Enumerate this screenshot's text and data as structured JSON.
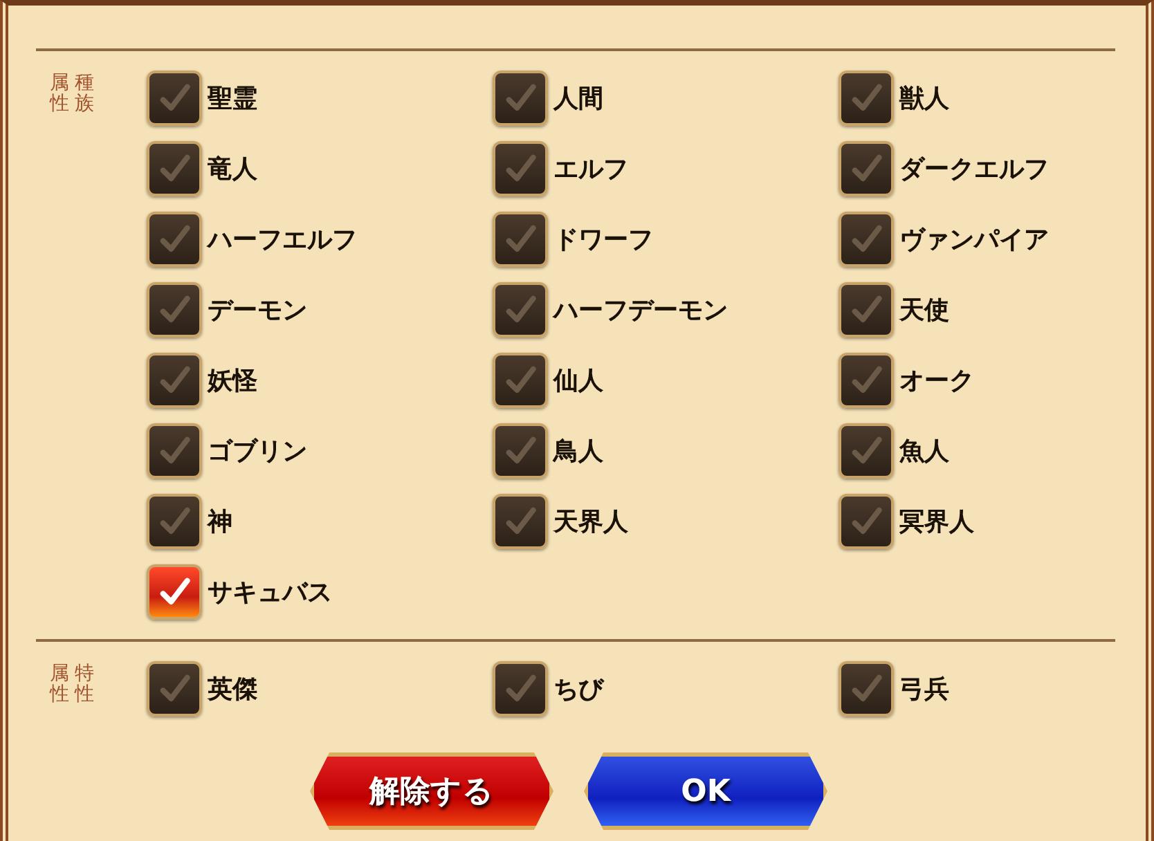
{
  "sections": [
    {
      "label_columns": [
        "属性",
        "種族"
      ],
      "options": [
        {
          "label": "聖霊",
          "checked": false
        },
        {
          "label": "人間",
          "checked": false
        },
        {
          "label": "獣人",
          "checked": false
        },
        {
          "label": "竜人",
          "checked": false
        },
        {
          "label": "エルフ",
          "checked": false
        },
        {
          "label": "ダークエルフ",
          "checked": false
        },
        {
          "label": "ハーフエルフ",
          "checked": false
        },
        {
          "label": "ドワーフ",
          "checked": false
        },
        {
          "label": "ヴァンパイア",
          "checked": false
        },
        {
          "label": "デーモン",
          "checked": false
        },
        {
          "label": "ハーフデーモン",
          "checked": false
        },
        {
          "label": "天使",
          "checked": false
        },
        {
          "label": "妖怪",
          "checked": false
        },
        {
          "label": "仙人",
          "checked": false
        },
        {
          "label": "オーク",
          "checked": false
        },
        {
          "label": "ゴブリン",
          "checked": false
        },
        {
          "label": "鳥人",
          "checked": false
        },
        {
          "label": "魚人",
          "checked": false
        },
        {
          "label": "神",
          "checked": false
        },
        {
          "label": "天界人",
          "checked": false
        },
        {
          "label": "冥界人",
          "checked": false
        },
        {
          "label": "サキュバス",
          "checked": true
        }
      ]
    },
    {
      "label_columns": [
        "属性",
        "特性"
      ],
      "options": [
        {
          "label": "英傑",
          "checked": false
        },
        {
          "label": "ちび",
          "checked": false
        },
        {
          "label": "弓兵",
          "checked": false
        }
      ]
    }
  ],
  "buttons": [
    {
      "label": "解除する",
      "kind": "clear"
    },
    {
      "label": "OK",
      "kind": "ok"
    }
  ]
}
